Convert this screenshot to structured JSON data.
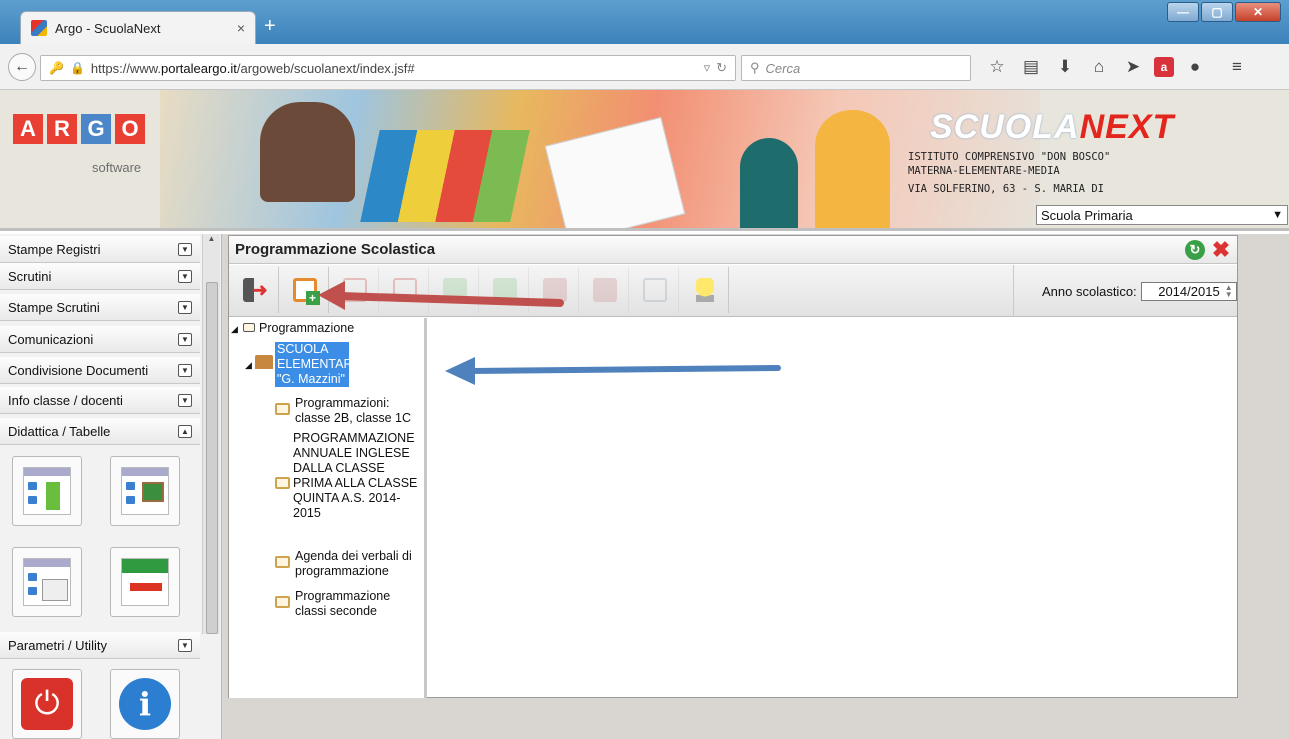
{
  "browser": {
    "tab_title": "Argo - ScuolaNext",
    "tab_close": "×",
    "new_tab": "+",
    "url_host": "https://www.",
    "url_domain": "portaleargo.it",
    "url_path": "/argoweb/scuolanext/index.jsf#",
    "search_placeholder": "Cerca"
  },
  "banner": {
    "logo_letters": [
      "A",
      "R",
      "G",
      "O"
    ],
    "logo_colors": [
      "#e84133",
      "#e84133",
      "#4a86c8",
      "#e84133"
    ],
    "logo_sub": "software",
    "brand_part1": "SCUOLA",
    "brand_part2": "NEXT",
    "school_line1": "ISTITUTO COMPRENSIVO \"DON BOSCO\"",
    "school_line2": "MATERNA-ELEMENTARE-MEDIA",
    "school_line3": "VIA SOLFERINO, 63 - S. MARIA DI",
    "school_select": "Scuola Primaria"
  },
  "sidebar": {
    "menus": [
      {
        "label": "Stampe Registri"
      },
      {
        "label": "Scrutini"
      },
      {
        "label": "Stampe Scrutini"
      },
      {
        "label": "Comunicazioni"
      },
      {
        "label": "Condivisione Documenti"
      },
      {
        "label": "Info classe / docenti"
      },
      {
        "label": "Didattica / Tabelle"
      },
      {
        "label": "Parametri / Utility"
      }
    ]
  },
  "panel": {
    "title": "Programmazione Scolastica",
    "anno_label": "Anno scolastico:",
    "anno_value": "2014/2015"
  },
  "tree": {
    "root": "Programmazione",
    "school": "SCUOLA ELEMENTARE \"G. Mazzini\"",
    "items": [
      "Programmazioni: classe 2B, classe 1C",
      "PROGRAMMAZIONE ANNUALE INGLESE DALLA CLASSE PRIMA ALLA CLASSE QUINTA A.S. 2014-2015",
      "Agenda dei verbali di programmazione",
      "Programmazione classi seconde"
    ]
  },
  "colors": {
    "accent_blue": "#4a86c8",
    "arrow_red": "#c0504d",
    "arrow_blue": "#4f81bd",
    "selection": "#3c8de5"
  }
}
